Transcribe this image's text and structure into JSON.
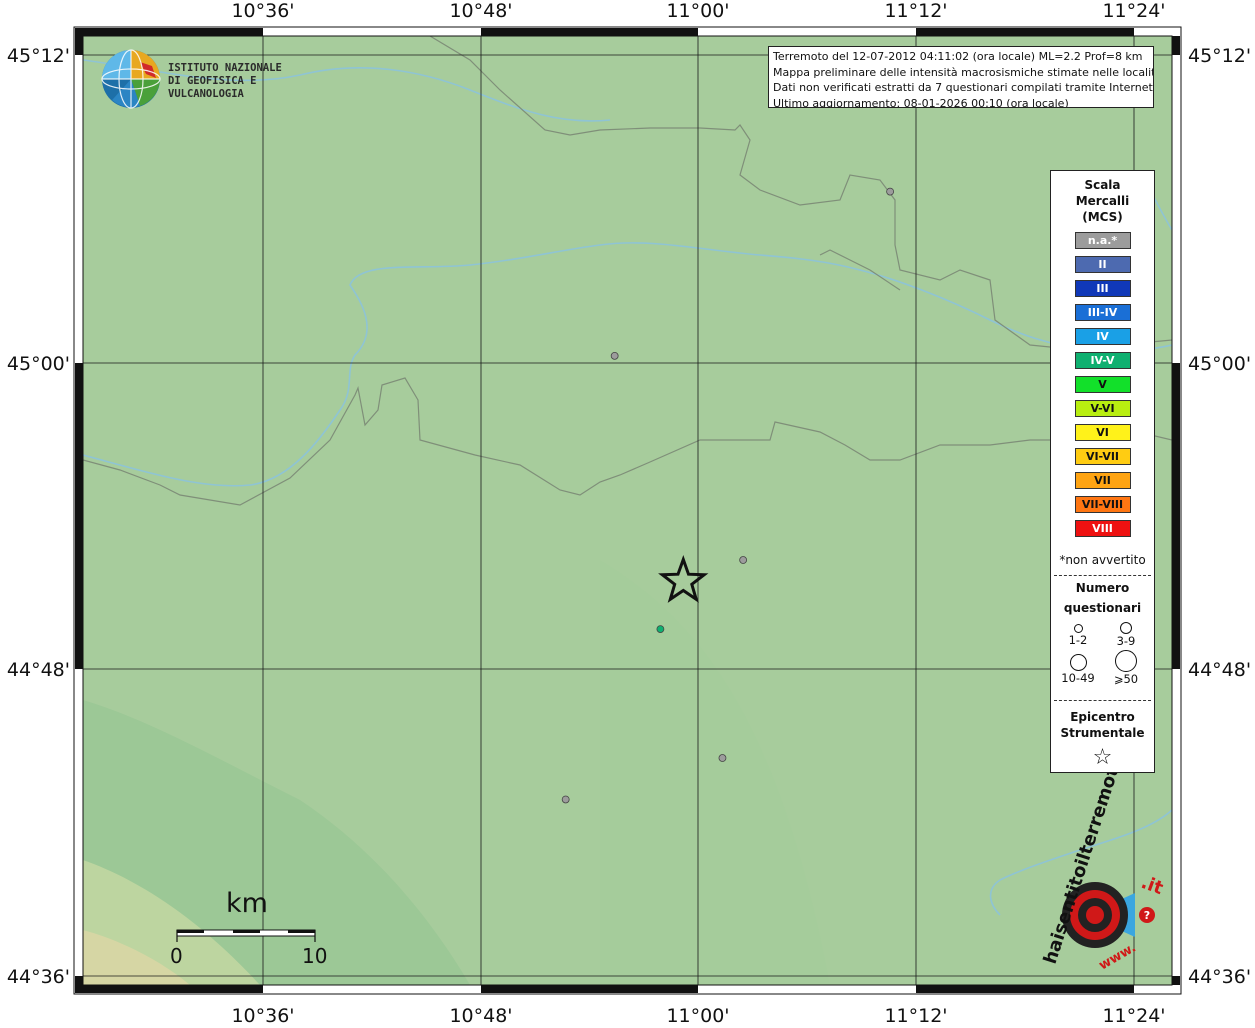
{
  "map": {
    "title_lines": [
      "Terremoto del 12-07-2012 04:11:02 (ora locale) ML=2.2 Prof=8 km",
      "Mappa preliminare delle intensità macrosismiche stimate nelle località",
      "Dati non verificati estratti da 7 questionari compilati tramite Internet.",
      "Ultimo aggiornamento: 08-01-2026 00:10 (ora locale)"
    ],
    "lon_labels": [
      "10°36'",
      "10°48'",
      "11°00'",
      "11°12'",
      "11°24'"
    ],
    "lat_labels": [
      "45°12'",
      "45°00'",
      "44°48'",
      "44°36'"
    ],
    "colors": {
      "land_green": "#a7cc9c",
      "lowland_dark": "#8fbf8c",
      "hills": "#c9d6a3",
      "river": "#8fc4d4",
      "border": "#7f8f79"
    }
  },
  "logo_ingv": {
    "line1": "ISTITUTO NAZIONALE",
    "line2": "DI GEOFISICA E VULCANOLOGIA"
  },
  "logo_hsit": {
    "text_main": "haisentitoilterremoto",
    "text_suffix": ".it",
    "text_www": "www."
  },
  "legend": {
    "title": [
      "Scala",
      "Mercalli",
      "(MCS)"
    ],
    "classes": [
      {
        "label": "n.a.*",
        "color": "#9c9c9c"
      },
      {
        "label": "II",
        "color": "#4d6ab0"
      },
      {
        "label": "III",
        "color": "#1038b8"
      },
      {
        "label": "III-IV",
        "color": "#1a6fd6"
      },
      {
        "label": "IV",
        "color": "#1aa0e6"
      },
      {
        "label": "IV-V",
        "color": "#0fb070"
      },
      {
        "label": "V",
        "color": "#12e02a"
      },
      {
        "label": "V-VI",
        "color": "#b8ee10"
      },
      {
        "label": "VI",
        "color": "#fff21a"
      },
      {
        "label": "VI-VII",
        "color": "#ffcc12"
      },
      {
        "label": "VII",
        "color": "#ffa412"
      },
      {
        "label": "VII-VIII",
        "color": "#ff7612"
      },
      {
        "label": "VIII",
        "color": "#ee1111"
      }
    ],
    "note": "*non avvertito",
    "count_title": [
      "Numero",
      "questionari"
    ],
    "count_classes": [
      "1-2",
      "3-9",
      "10-49",
      "⩾50"
    ],
    "epicenter_title": [
      "Epicentro",
      "Strumentale"
    ]
  },
  "observations": [
    {
      "lon": 11.176,
      "lat": 45.111,
      "intensity": "n.a.*",
      "count": "1-2"
    },
    {
      "lon": 10.923,
      "lat": 45.004,
      "intensity": "n.a.*",
      "count": "1-2"
    },
    {
      "lon": 11.041,
      "lat": 44.871,
      "intensity": "n.a.*",
      "count": "1-2"
    },
    {
      "lon": 10.965,
      "lat": 44.826,
      "intensity": "IV-V",
      "count": "1-2"
    },
    {
      "lon": 11.022,
      "lat": 44.742,
      "intensity": "n.a.*",
      "count": "1-2"
    },
    {
      "lon": 10.878,
      "lat": 44.715,
      "intensity": "n.a.*",
      "count": "1-2"
    }
  ],
  "epicenter": {
    "lon": 10.986,
    "lat": 44.857
  },
  "scale_bar": {
    "unit": "km",
    "start": "0",
    "end": "10"
  }
}
